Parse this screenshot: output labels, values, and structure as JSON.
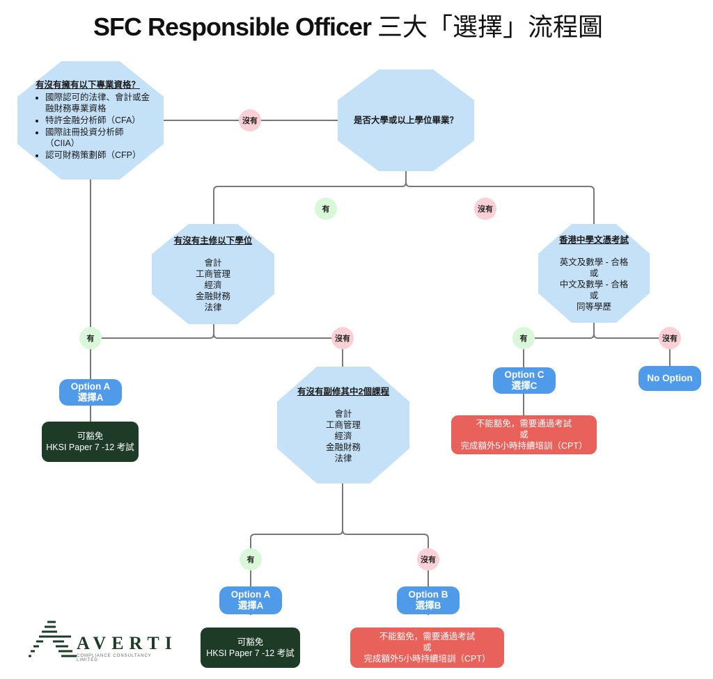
{
  "title": {
    "en": "SFC Responsible Officer",
    "zh": "三大「選擇」流程圖"
  },
  "colors": {
    "question_fill": "#c5e1f8",
    "yes_badge": "#d9f7d9",
    "no_badge": "#f8d0d6",
    "option_fill": "#4f9be9",
    "exempt_fill": "#1d3b27",
    "not_exempt_fill": "#e9615b",
    "connector": "#777777"
  },
  "nodes": {
    "q_professional": {
      "question": "有沒有擁有以下專業資格？",
      "items": [
        "國際認可的法律、會計或金融財務專業資格",
        "特許金融分析師（CFA）",
        "國際註冊投資分析師（CIIA）",
        "認可財務策劃師（CFP）"
      ]
    },
    "q_degree": {
      "question": "是否大學或以上學位畢業？"
    },
    "q_major": {
      "question": "有沒有主修以下學位",
      "items": [
        "會計",
        "工商管理",
        "經濟",
        "金融財務",
        "法律"
      ]
    },
    "q_hkdse": {
      "question": "香港中學文憑考試",
      "items": [
        "英文及數學 - 合格",
        "或",
        "中文及數學 - 合格",
        "或",
        "同等學歷"
      ]
    },
    "q_minor": {
      "question": "有沒有副修其中2個課程",
      "items": [
        "會計",
        "工商管理",
        "經濟",
        "金融財務",
        "法律"
      ]
    }
  },
  "badges": {
    "yes": "有",
    "no": "沒有"
  },
  "options": {
    "a1": {
      "line1": "Option A",
      "line2": "選擇A"
    },
    "a2": {
      "line1": "Option A",
      "line2": "選擇A"
    },
    "b": {
      "line1": "Option B",
      "line2": "選擇B"
    },
    "c": {
      "line1": "Option C",
      "line2": "選擇C"
    },
    "none": {
      "line1": "No Option"
    }
  },
  "results": {
    "exempt": {
      "line1": "可豁免",
      "line2": "HKSI Paper 7 -12 考試"
    },
    "not_exempt": {
      "line1": "不能豁免，需要通過考試",
      "line2": "或",
      "line3": "完成額外5小時持續培訓（CPT）"
    }
  },
  "logo": {
    "name": "AVERTI",
    "tagline": "COMPLIANCE CONSULTANCY LIMITED"
  }
}
